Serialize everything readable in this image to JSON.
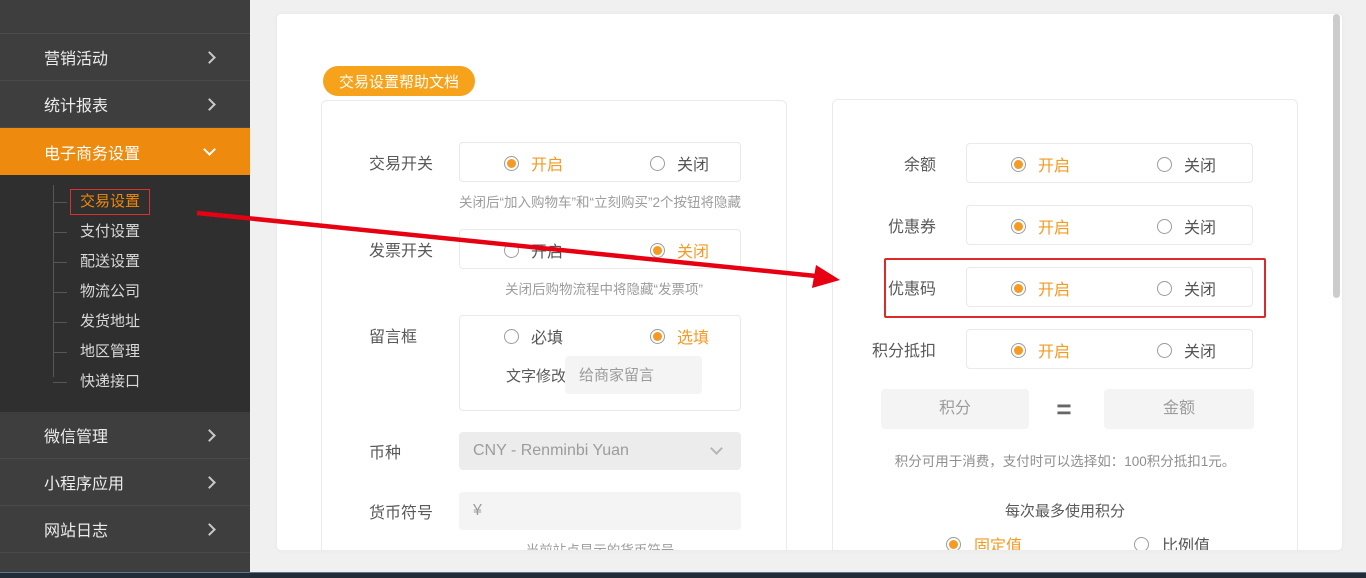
{
  "colors": {
    "accent_orange": "#f59a23",
    "sidebar_active_bg": "#ee8b0e",
    "help_button_bg": "#f7a21b",
    "annotation_red": "#dc2a2a"
  },
  "sidebar": {
    "items": [
      {
        "label": "营销活动"
      },
      {
        "label": "统计报表"
      },
      {
        "label": "电子商务设置"
      },
      {
        "label": "微信管理"
      },
      {
        "label": "小程序应用"
      },
      {
        "label": "网站日志"
      }
    ],
    "submenu": [
      {
        "label": "交易设置"
      },
      {
        "label": "支付设置"
      },
      {
        "label": "配送设置"
      },
      {
        "label": "物流公司"
      },
      {
        "label": "发货地址"
      },
      {
        "label": "地区管理"
      },
      {
        "label": "快递接口"
      }
    ]
  },
  "toolbar": {
    "help_button": "交易设置帮助文档"
  },
  "trade_panel": {
    "trade_switch": {
      "label": "交易开关",
      "opt_on": "开启",
      "opt_off": "关闭",
      "helper": "关闭后“加入购物车”和“立刻购买”2个按钮将隐藏"
    },
    "invoice_switch": {
      "label": "发票开关",
      "opt_on": "开启",
      "opt_off": "关闭",
      "helper": "关闭后购物流程中将隐藏“发票项”"
    },
    "message_box": {
      "label": "留言框",
      "opt_required": "必填",
      "opt_optional": "选填",
      "text_label": "文字修改",
      "placeholder": "给商家留言"
    },
    "currency": {
      "label": "币种",
      "value": "CNY - Renminbi Yuan"
    },
    "currency_symbol": {
      "label": "货币符号",
      "value": "¥",
      "helper": "当前站点显示的货币符号"
    }
  },
  "marketing_panel": {
    "balance": {
      "label": "余额",
      "opt_on": "开启",
      "opt_off": "关闭"
    },
    "coupon": {
      "label": "优惠券",
      "opt_on": "开启",
      "opt_off": "关闭"
    },
    "promo_code": {
      "label": "优惠码",
      "opt_on": "开启",
      "opt_off": "关闭"
    },
    "points_deduct": {
      "label": "积分抵扣",
      "opt_on": "开启",
      "opt_off": "关闭"
    },
    "points_rate": {
      "points_placeholder": "积分",
      "equals": "=",
      "amount_placeholder": "金额",
      "note": "积分可用于消费，支付时可以选择如：100积分抵扣1元。",
      "max_points_title": "每次最多使用积分",
      "opt_fixed": "固定值",
      "opt_ratio": "比例值"
    }
  }
}
